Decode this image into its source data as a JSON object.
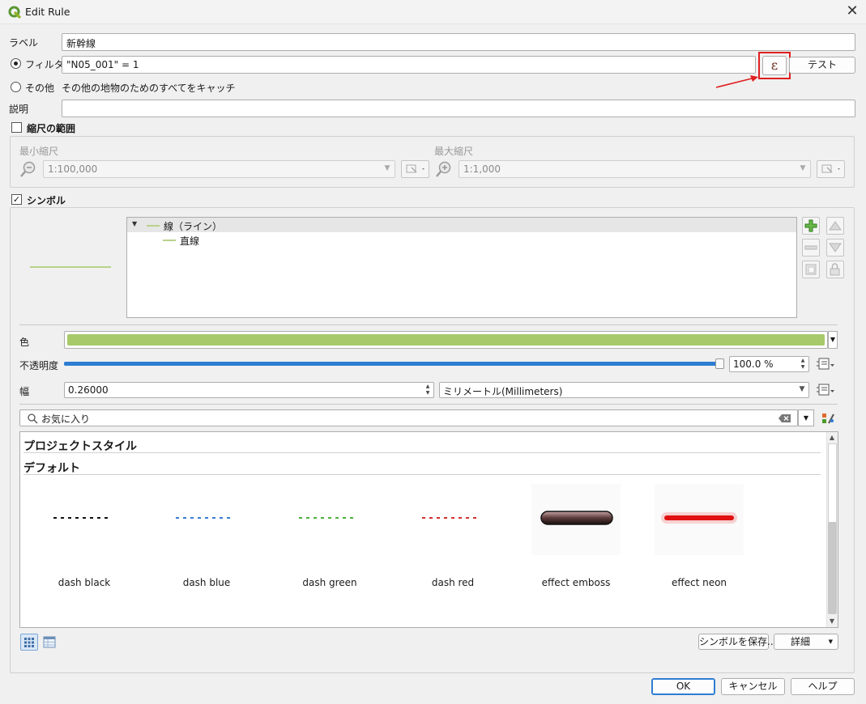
{
  "window": {
    "title": "Edit Rule",
    "close_glyph": "✕"
  },
  "form": {
    "label_caption": "ラベル",
    "label_value": "新幹線",
    "filter_caption": "フィルタ",
    "filter_value": "\"N05_001\" = 1",
    "expression_glyph": "ε",
    "test_button": "テスト",
    "else_caption": "その他",
    "else_text": "その他の地物のためのすべてをキャッチ",
    "description_caption": "説明",
    "description_value": ""
  },
  "scale": {
    "checkbox_label": "縮尺の範囲",
    "checked": false,
    "min_caption": "最小縮尺",
    "min_value": "1:100,000",
    "max_caption": "最大縮尺",
    "max_value": "1:1,000"
  },
  "symbol": {
    "checkbox_label": "シンボル",
    "checked": true,
    "preview_color": "#b9d28a",
    "tree": [
      {
        "label": "線（ライン）",
        "level": 0
      },
      {
        "label": "直線",
        "level": 1
      }
    ],
    "color_caption": "色",
    "color_value": "#a7c96a",
    "opacity_caption": "不透明度",
    "opacity_value": "100.0 %",
    "opacity_level": 1.0,
    "width_caption": "幅",
    "width_value": "0.26000",
    "unit_value": "ミリメートル(Millimeters)",
    "search_placeholder": "お気に入り"
  },
  "library": {
    "groups": [
      "プロジェクトスタイル",
      "デフォルト"
    ],
    "items": [
      {
        "name": "dash  black",
        "color": "#111111",
        "style": "dash"
      },
      {
        "name": "dash blue",
        "color": "#3a7bd5",
        "style": "dash"
      },
      {
        "name": "dash green",
        "color": "#4caf3e",
        "style": "dash"
      },
      {
        "name": "dash red",
        "color": "#d32f2f",
        "style": "dash"
      },
      {
        "name": "effect emboss",
        "color": "#3b2a2a",
        "style": "emboss"
      },
      {
        "name": "effect neon",
        "color": "#e01010",
        "style": "neon"
      }
    ],
    "save_symbol_button": "シンボルを保存...",
    "advanced_button": "詳細"
  },
  "footer": {
    "ok": "OK",
    "cancel": "キャンセル",
    "help": "ヘルプ"
  },
  "annotation": {
    "highlight_color": "#e02020"
  }
}
